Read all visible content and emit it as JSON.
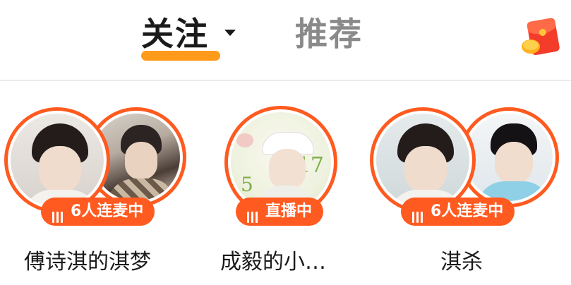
{
  "tabs": {
    "follow_label": "关注",
    "recommend_label": "推荐"
  },
  "icons": {
    "dropdown": "caret-down-icon",
    "red_packet": "red-packet-icon",
    "live_bars": "sound-bars-icon"
  },
  "colors": {
    "accent_orange": "#ff5a1f",
    "tab_underline": "#ff9a1a",
    "text_primary": "#1a1a1a",
    "text_secondary": "#8a8a8a"
  },
  "streams": [
    {
      "status": "6人连麦中",
      "name": "傅诗淇的淇梦"
    },
    {
      "status": "直播中",
      "name": "成毅的小…"
    },
    {
      "status": "6人连麦中",
      "name": "淇杀"
    }
  ]
}
